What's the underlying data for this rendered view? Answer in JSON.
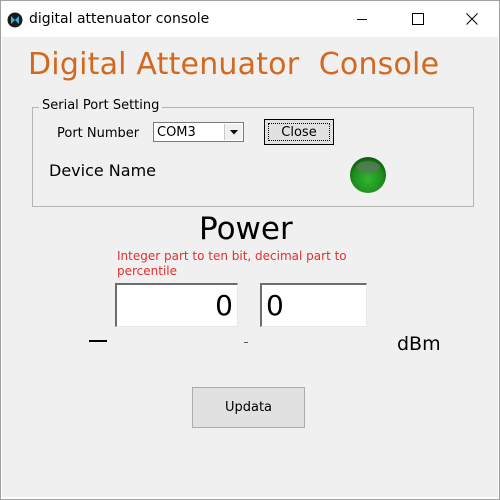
{
  "window": {
    "title": "digital attenuator console",
    "icon": "x-circle-icon"
  },
  "main": {
    "heading": "Digital Attenuator  Console",
    "serial": {
      "group_label": "Serial Port Setting",
      "port_label": "Port Number",
      "port_value": "COM3",
      "close_label": "Close",
      "status_color": "#1e8c1e"
    },
    "device_name_label": "Device Name",
    "power": {
      "label": "Power",
      "hint": "Integer part to ten bit, decimal part to percentile",
      "integer_value": "0",
      "decimal_value": "0",
      "unit": "dBm"
    },
    "update_label": "Updata"
  },
  "colors": {
    "heading": "#d2691e",
    "hint": "#e03030",
    "background": "#f0f0f0"
  }
}
